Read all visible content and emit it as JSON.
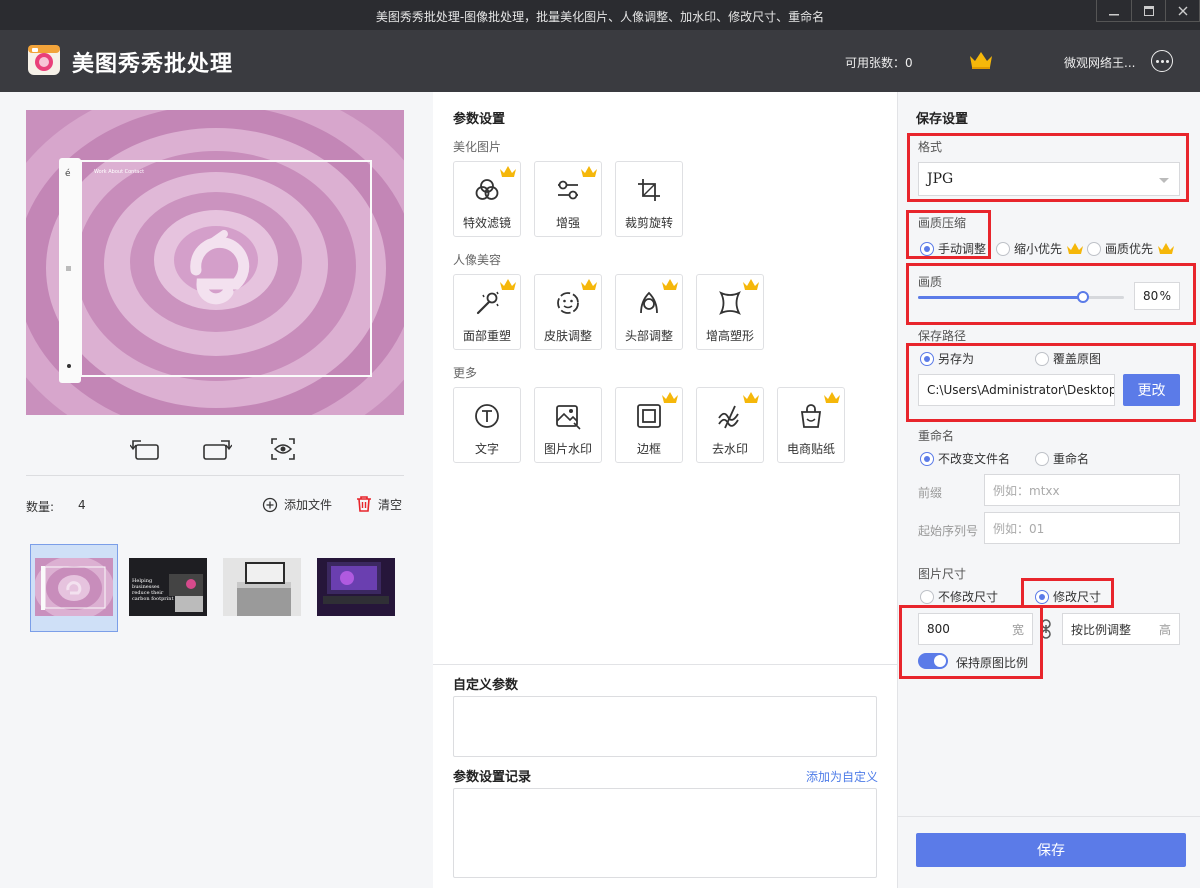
{
  "window": {
    "title": "美图秀秀批处理-图像批处理，批量美化图片、人像调整、加水印、修改尺寸、重命名"
  },
  "header": {
    "app_name": "美图秀秀批处理",
    "available_count": "可用张数：0",
    "username": "微观网络王..."
  },
  "left": {
    "quantity_label": "数量:",
    "quantity_value": "4",
    "add_file": "添加文件",
    "clear": "清空"
  },
  "middle": {
    "params_title": "参数设置",
    "sections": [
      {
        "title": "美化图片",
        "tiles": [
          {
            "label": "特效滤镜",
            "vip": true,
            "icon": "filter-icon"
          },
          {
            "label": "增强",
            "vip": true,
            "icon": "enhance-icon"
          },
          {
            "label": "裁剪旋转",
            "vip": false,
            "icon": "crop-icon"
          }
        ]
      },
      {
        "title": "人像美容",
        "tiles": [
          {
            "label": "面部重塑",
            "vip": true,
            "icon": "magic-wand-icon"
          },
          {
            "label": "皮肤调整",
            "vip": true,
            "icon": "face-icon"
          },
          {
            "label": "头部调整",
            "vip": true,
            "icon": "head-icon"
          },
          {
            "label": "增高塑形",
            "vip": true,
            "icon": "body-icon"
          }
        ]
      },
      {
        "title": "更多",
        "tiles": [
          {
            "label": "文字",
            "vip": false,
            "icon": "text-icon"
          },
          {
            "label": "图片水印",
            "vip": false,
            "icon": "image-watermark-icon"
          },
          {
            "label": "边框",
            "vip": true,
            "icon": "border-icon"
          },
          {
            "label": "去水印",
            "vip": true,
            "icon": "remove-watermark-icon"
          },
          {
            "label": "电商贴纸",
            "vip": true,
            "icon": "shopping-bag-icon"
          }
        ]
      }
    ],
    "custom_params_title": "自定义参数",
    "history_title": "参数设置记录",
    "add_custom": "添加为自定义"
  },
  "right": {
    "title": "保存设置",
    "format_label": "格式",
    "format_value": "JPG",
    "compress_label": "画质压缩",
    "compress_options": [
      "手动调整",
      "缩小优先",
      "画质优先"
    ],
    "quality_label": "画质",
    "quality_value": "80",
    "quality_unit": "%",
    "quality_percent": 80,
    "path_label": "保存路径",
    "path_options": [
      "另存为",
      "覆盖原图"
    ],
    "path_value": "C:\\Users\\Administrator\\Desktop",
    "change_button": "更改",
    "rename_label": "重命名",
    "rename_options": [
      "不改变文件名",
      "重命名"
    ],
    "prefix_label": "前缀",
    "prefix_placeholder": "例如：mtxx",
    "seq_label": "起始序列号",
    "seq_placeholder": "例如：01",
    "size_label": "图片尺寸",
    "size_options": [
      "不修改尺寸",
      "修改尺寸"
    ],
    "width_value": "800",
    "width_unit": "宽",
    "height_placeholder": "按比例调整",
    "height_unit": "高",
    "keep_ratio": "保持原图比例",
    "save_button": "保存"
  },
  "colors": {
    "accent": "#5b7be8",
    "highlight": "#e8252c",
    "crown": "#f5b70a"
  }
}
